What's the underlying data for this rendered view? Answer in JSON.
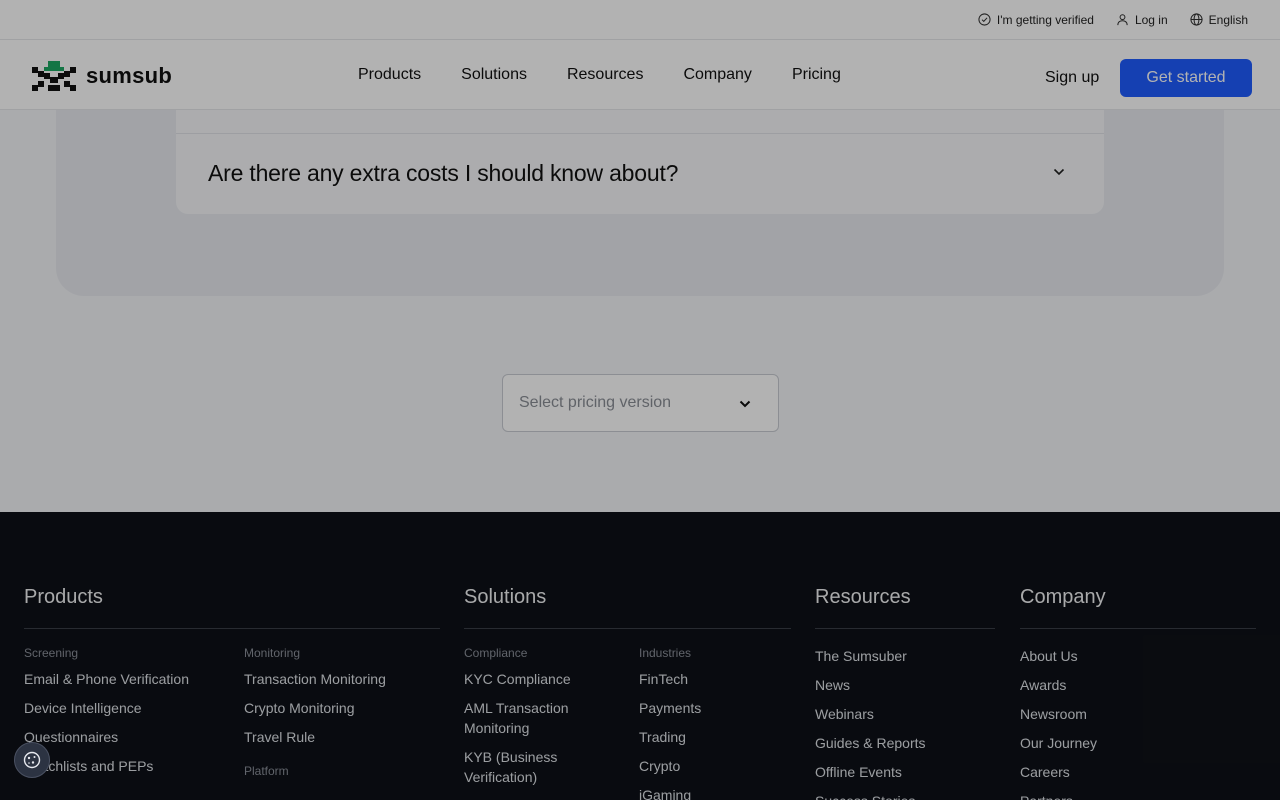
{
  "utility": {
    "verify": "I'm getting verified",
    "login": "Log in",
    "language": "English"
  },
  "header": {
    "logo_text": "sumsub",
    "nav": [
      "Products",
      "Solutions",
      "Resources",
      "Company",
      "Pricing"
    ],
    "signup": "Sign up",
    "cta": "Get started"
  },
  "faq": {
    "question": "Are there any extra costs I should know about?"
  },
  "pricing_select": {
    "placeholder": "Select pricing version"
  },
  "footer": {
    "products": {
      "title": "Products",
      "screening_label": "Screening",
      "screening_items": [
        "Email & Phone Verification",
        "Device Intelligence",
        "Questionnaires",
        "Watchlists and PEPs"
      ],
      "monitoring_label": "Monitoring",
      "monitoring_items": [
        "Transaction Monitoring",
        "Crypto Monitoring",
        "Travel Rule"
      ],
      "platform_label": "Platform"
    },
    "solutions": {
      "title": "Solutions",
      "compliance_label": "Compliance",
      "compliance_items": [
        "KYC Compliance",
        "AML Transaction Monitoring",
        "KYB (Business Verification)"
      ],
      "industries_label": "Industries",
      "industries_items": [
        "FinTech",
        "Payments",
        "Trading",
        "Crypto",
        "iGaming"
      ]
    },
    "resources": {
      "title": "Resources",
      "items": [
        "The Sumsuber",
        "News",
        "Webinars",
        "Guides & Reports",
        "Offline Events",
        "Success Stories"
      ]
    },
    "company": {
      "title": "Company",
      "items": [
        "About Us",
        "Awards",
        "Newsroom",
        "Our Journey",
        "Careers",
        "Partners"
      ]
    }
  },
  "colors": {
    "accent": "#1f5cff",
    "footer_bg": "#0e1117",
    "logo_green": "#1ea863"
  }
}
